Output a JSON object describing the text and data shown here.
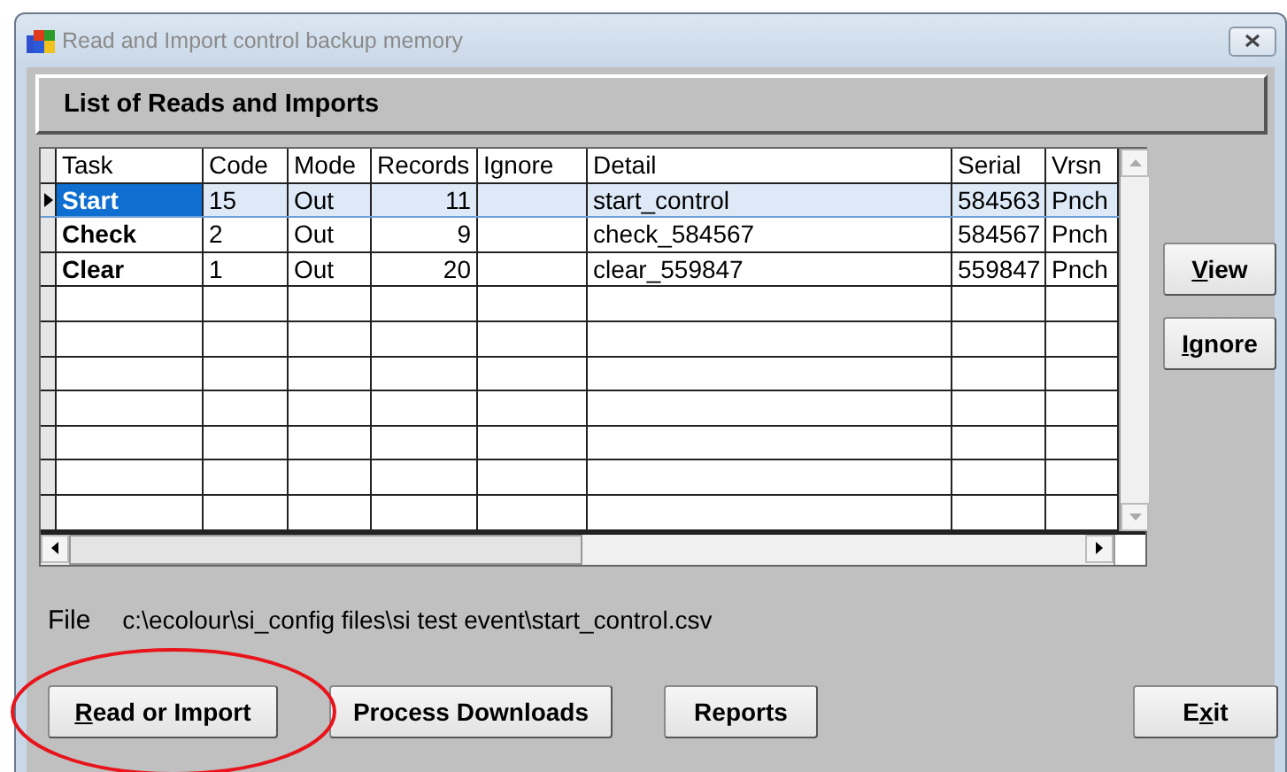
{
  "window": {
    "title": "Read and Import control backup memory"
  },
  "panel_title": "List of Reads and Imports",
  "table": {
    "columns": [
      "Task",
      "Code",
      "Mode",
      "Records",
      "Ignore",
      "Detail",
      "Serial",
      "Vrsn"
    ],
    "rows": [
      {
        "task": "Start",
        "code": "15",
        "mode": "Out",
        "records": "11",
        "detail": "start_control",
        "serial": "584563",
        "vrsn": "Pnch",
        "selected": true
      },
      {
        "task": "Check",
        "code": "2",
        "mode": "Out",
        "records": "9",
        "detail": "check_584567",
        "serial": "584567",
        "vrsn": "Pnch",
        "selected": false
      },
      {
        "task": "Clear",
        "code": "1",
        "mode": "Out",
        "records": "20",
        "detail": "clear_559847",
        "serial": "559847",
        "vrsn": "Pnch",
        "selected": false
      }
    ]
  },
  "side_buttons": [
    {
      "accel": "V",
      "label_end": "iew"
    },
    {
      "accel": "I",
      "label_end": "gnore"
    }
  ],
  "file": {
    "label": "File",
    "path": "c:\\ecolour\\si_config files\\si test event\\start_control.csv"
  },
  "bottom_buttons": [
    {
      "accel": "R",
      "label_end": "ead or Import"
    },
    {
      "label": "Process Downloads"
    },
    {
      "label": "Reports"
    },
    {
      "label_start": "E",
      "accel": "x",
      "label_end": "it"
    }
  ],
  "annotation": {
    "kind": "ellipse",
    "color": "#e8141b"
  }
}
